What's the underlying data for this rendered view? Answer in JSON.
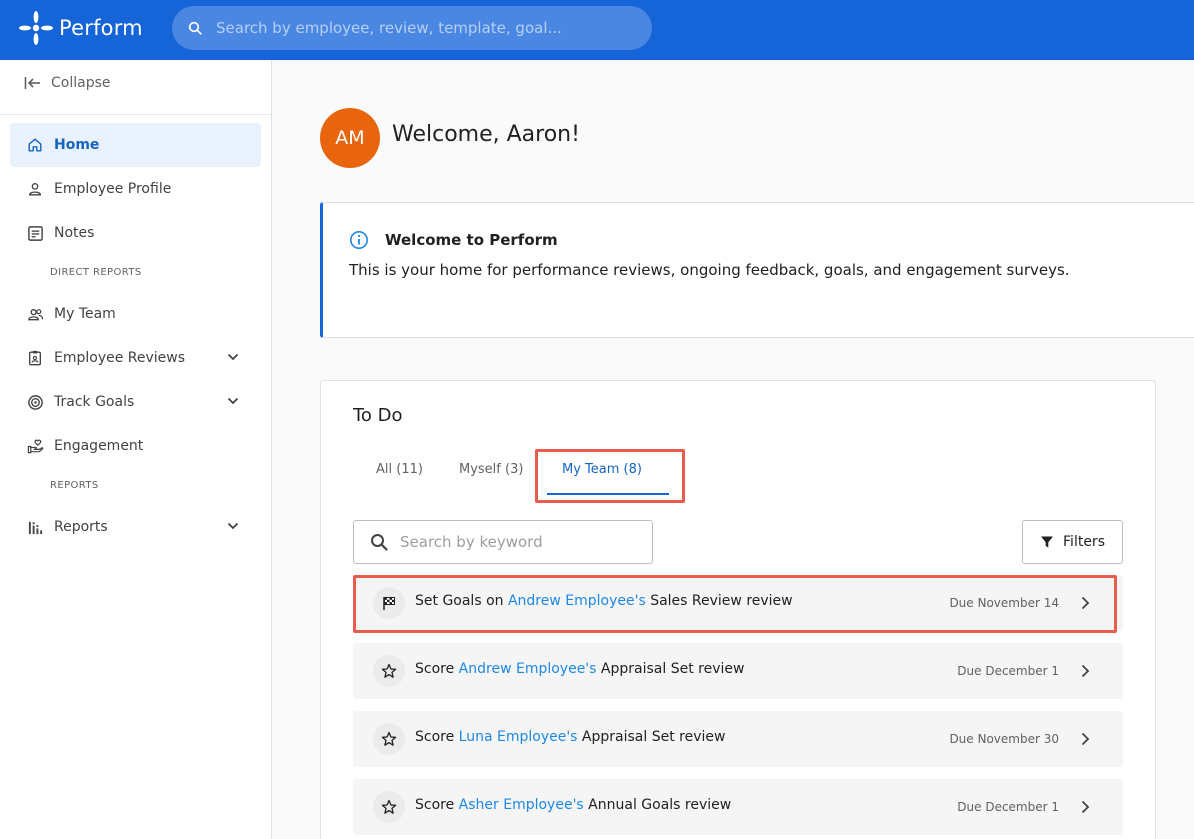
{
  "app": {
    "name": "Perform",
    "search_placeholder": "Search by employee, review, template, goal..."
  },
  "sidebar": {
    "collapse_label": "Collapse",
    "items": [
      {
        "label": "Home",
        "icon": "home-icon",
        "active": true
      },
      {
        "label": "Employee Profile",
        "icon": "person-icon"
      },
      {
        "label": "Notes",
        "icon": "notes-icon"
      },
      {
        "label": "My Team",
        "icon": "team-icon"
      },
      {
        "label": "Employee Reviews",
        "icon": "reviews-icon",
        "expandable": true
      },
      {
        "label": "Track Goals",
        "icon": "target-icon",
        "expandable": true
      },
      {
        "label": "Engagement",
        "icon": "engagement-icon"
      },
      {
        "label": "Reports",
        "icon": "bar-chart-icon",
        "expandable": true
      }
    ],
    "sections": {
      "direct_reports": "DIRECT REPORTS",
      "reports": "REPORTS"
    }
  },
  "user": {
    "initials": "AM",
    "welcome": "Welcome, Aaron!",
    "avatar_color": "#e8650e"
  },
  "info_card": {
    "title": "Welcome to Perform",
    "body": "This is your home for performance reviews, ongoing feedback, goals, and engagement surveys."
  },
  "todo": {
    "title": "To Do",
    "tabs": [
      {
        "label": "All (11)"
      },
      {
        "label": "Myself (3)"
      },
      {
        "label": "My Team (8)",
        "active": true
      }
    ],
    "search_placeholder": "Search by keyword",
    "filters_label": "Filters",
    "tasks": [
      {
        "icon": "flag-icon",
        "prefix": "Set Goals on ",
        "person": "Andrew Employee's",
        "suffix": " Sales Review review",
        "due": "Due November 14"
      },
      {
        "icon": "star-icon",
        "prefix": "Score ",
        "person": "Andrew Employee's",
        "suffix": " Appraisal Set review",
        "due": "Due December 1"
      },
      {
        "icon": "star-icon",
        "prefix": "Score ",
        "person": "Luna Employee's",
        "suffix": " Appraisal Set review",
        "due": "Due November 30"
      },
      {
        "icon": "star-icon",
        "prefix": "Score ",
        "person": "Asher Employee's",
        "suffix": " Annual Goals review",
        "due": "Due December 1"
      }
    ]
  },
  "colors": {
    "brand_blue": "#1565d8",
    "link_blue": "#1e88e5",
    "highlight_red": "#e85d4d"
  }
}
